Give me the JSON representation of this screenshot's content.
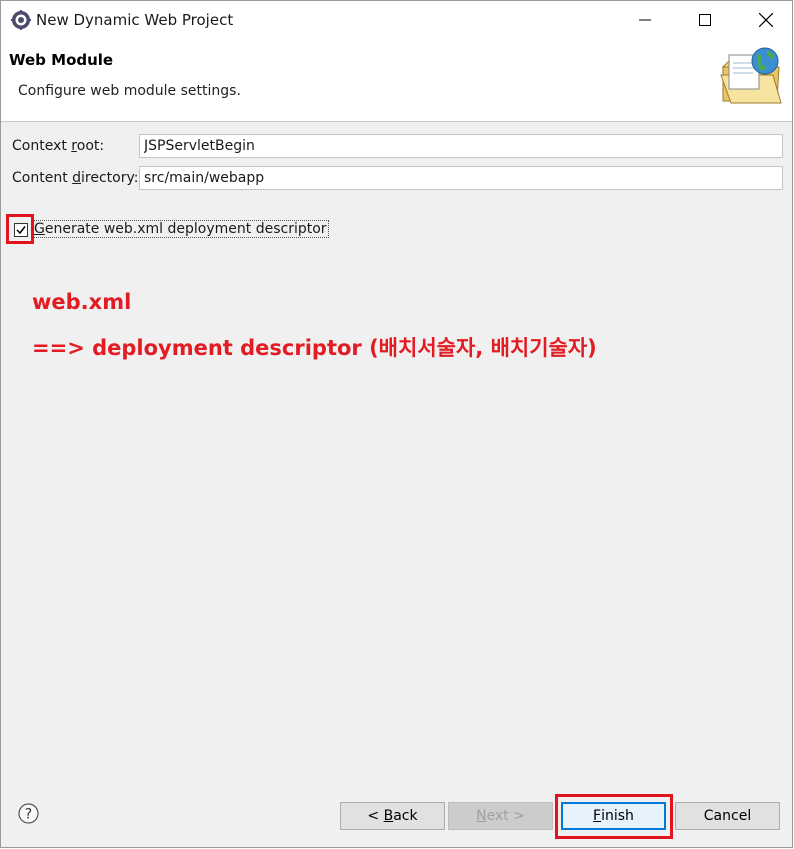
{
  "window": {
    "title": "New Dynamic Web Project",
    "app_icon": "eclipse-gear-icon"
  },
  "banner": {
    "title": "Web Module",
    "description": "Configure web module settings.",
    "graphic": "folder-globe-icon"
  },
  "form": {
    "context_root": {
      "label_pre": "Context ",
      "label_mnemonic": "r",
      "label_post": "oot:",
      "value": "JSPServletBegin"
    },
    "content_directory": {
      "label_pre": "Content ",
      "label_mnemonic": "d",
      "label_post": "irectory:",
      "value": "src/main/webapp"
    },
    "generate_descriptor": {
      "label_mnemonic": "G",
      "label_post": "enerate web.xml deployment descriptor",
      "checked": true
    }
  },
  "annotation": {
    "line1": "web.xml",
    "line2": "==> deployment descriptor (배치서술자, 배치기술자)",
    "color": "#e31b23"
  },
  "buttons": {
    "back": {
      "pre": "< ",
      "mnemonic": "B",
      "post": "ack"
    },
    "next": {
      "mnemonic": "N",
      "post": "ext >"
    },
    "finish": {
      "mnemonic": "F",
      "post": "inish"
    },
    "cancel": "Cancel"
  }
}
